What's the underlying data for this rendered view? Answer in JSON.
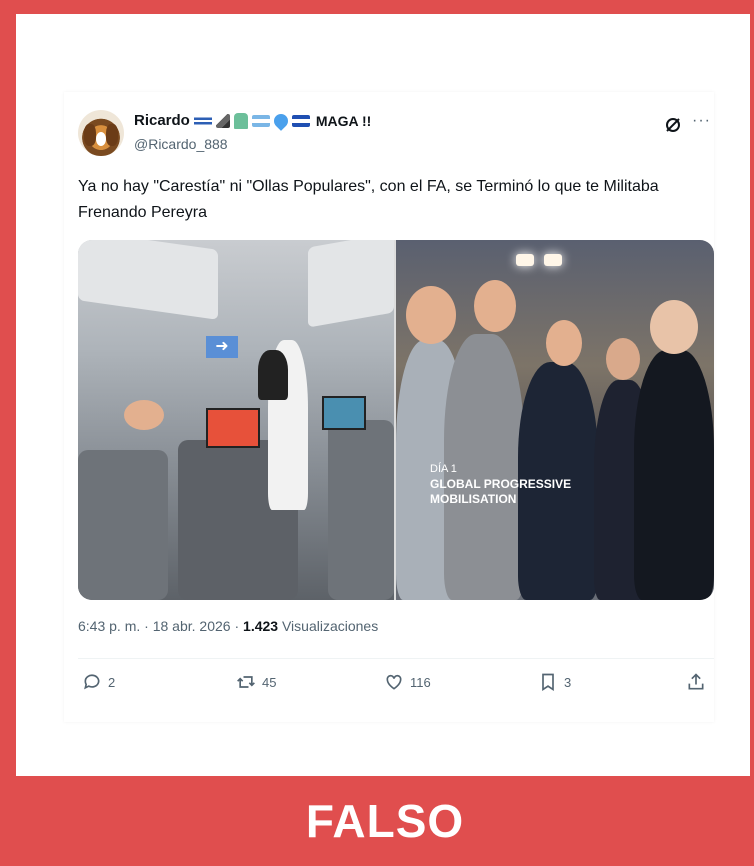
{
  "tweet": {
    "display_name": "Ricardo",
    "name_suffix": "MAGA !!",
    "handle": "@Ricardo_888",
    "text": "Ya no hay \"Carestía\" ni \"Ollas Populares\", con el FA, se Terminó lo que te Militaba Frenando Pereyra",
    "time": "6:43 p. m.",
    "date": "18 abr. 2026",
    "views_count": "1.423",
    "views_label": "Visualizaciones",
    "replies": "2",
    "reposts": "45",
    "likes": "116",
    "bookmarks": "3",
    "photo_caption_line1": "DÍA 1",
    "photo_caption_line2": "GLOBAL PROGRESSIVE",
    "photo_caption_line3": "MOBILISATION"
  },
  "banner": {
    "label": "FALSO"
  },
  "colors": {
    "accent_red": "#e04e4e",
    "text_primary": "#0f1419",
    "text_secondary": "#536471"
  }
}
